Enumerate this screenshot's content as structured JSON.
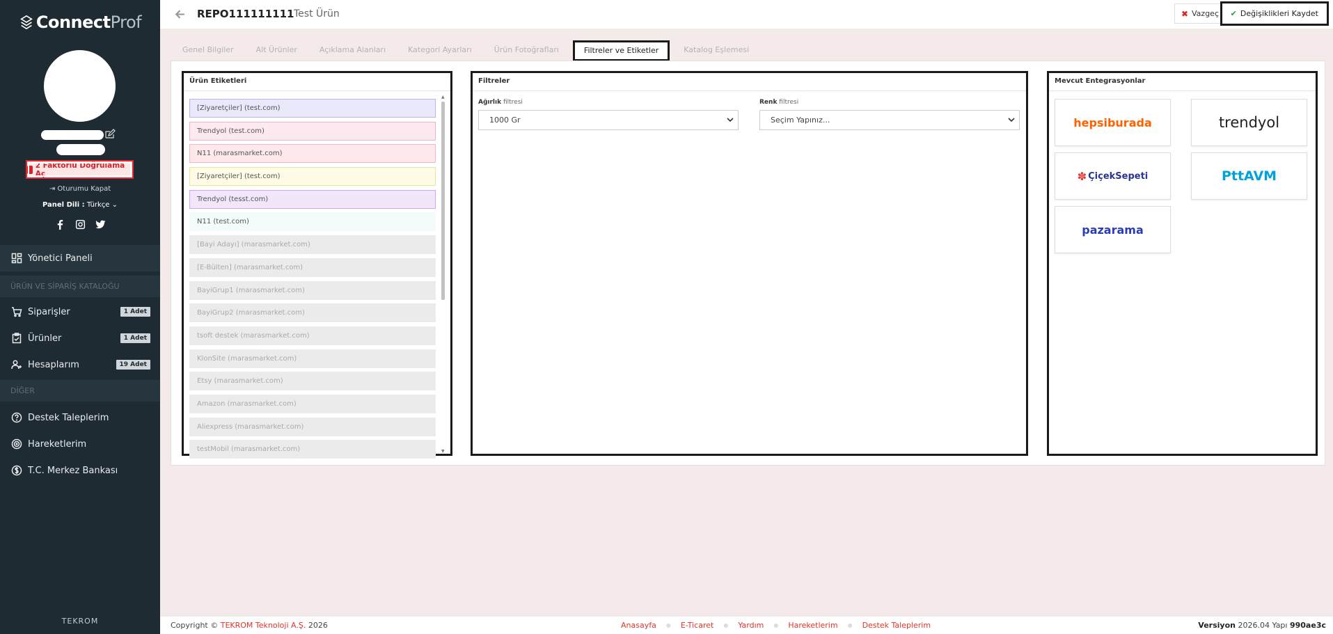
{
  "sidebar": {
    "logo_bold": "Connect",
    "logo_light": "Prof",
    "twofa_label": "2 Faktörlü Doğrulama Aç",
    "logout_label": "Oturumu Kapat",
    "lang_label": "Panel Dili :",
    "lang_value": "Türkçe",
    "items": [
      {
        "label": "Yönetici Paneli",
        "icon": "dashboard-icon"
      },
      {
        "label": "Siparişler",
        "icon": "cart-icon",
        "badge": "1 Adet"
      },
      {
        "label": "Ürünler",
        "icon": "clipboard-icon",
        "badge": "1 Adet"
      },
      {
        "label": "Hesaplarım",
        "icon": "users-icon",
        "badge": "19 Adet"
      },
      {
        "label": "Destek Taleplerim",
        "icon": "help-icon"
      },
      {
        "label": "Hareketlerim",
        "icon": "activity-icon"
      },
      {
        "label": "T.C. Merkez Bankası",
        "icon": "currency-icon"
      }
    ],
    "sections": [
      "ÜRÜN VE SİPARİŞ KATALOĞU",
      "DİĞER"
    ],
    "footer_brand": "TEKROM"
  },
  "topbar": {
    "code": "REPO111111111",
    "name": "Test Ürün",
    "cancel_label": "Vazgeç",
    "save_label": "Değişiklikleri Kaydet"
  },
  "tabs": [
    "Genel Bilgiler",
    "Alt Ürünler",
    "Açıklama Alanları",
    "Kategori Ayarları",
    "Ürün Fotoğrafları",
    "Filtreler ve Etiketler",
    "Katalog Eşlemesi"
  ],
  "tags_panel": {
    "title": "Ürün Etiketleri",
    "tags": [
      {
        "label": "[Ziyaretçiler] (test.com)",
        "bg": "#e9e9fb",
        "border": "#b5b5e8",
        "color": "#555"
      },
      {
        "label": "Trendyol (test.com)",
        "bg": "#fde9f0",
        "border": "#f1b2c8",
        "color": "#555"
      },
      {
        "label": "N11 (marasmarket.com)",
        "bg": "#fde9ec",
        "border": "#f2b8c2",
        "color": "#555"
      },
      {
        "label": "[Ziyaretçiler] (test.com)",
        "bg": "#fdfbe6",
        "border": "#ece59f",
        "color": "#555"
      },
      {
        "label": "Trendyol (tesst.com)",
        "bg": "#f2e6fa",
        "border": "#cfa6ea",
        "color": "#555"
      },
      {
        "label": "N11 (test.com)",
        "bg": "#f3fbfd",
        "border": "#f3fbfd",
        "color": "#555"
      },
      {
        "label": "[Bayi Adayı] (marasmarket.com)",
        "bg": "#ebebeb",
        "border": "#ebebeb",
        "color": "#aaa"
      },
      {
        "label": "[E-Bülten] (marasmarket.com)",
        "bg": "#ebebeb",
        "border": "#ebebeb",
        "color": "#aaa"
      },
      {
        "label": "BayiGrup1 (marasmarket.com)",
        "bg": "#ebebeb",
        "border": "#ebebeb",
        "color": "#aaa"
      },
      {
        "label": "BayiGrup2 (marasmarket.com)",
        "bg": "#ebebeb",
        "border": "#ebebeb",
        "color": "#aaa"
      },
      {
        "label": "tsoft destek (marasmarket.com)",
        "bg": "#ebebeb",
        "border": "#ebebeb",
        "color": "#aaa"
      },
      {
        "label": "KlonSite (marasmarket.com)",
        "bg": "#ebebeb",
        "border": "#ebebeb",
        "color": "#aaa"
      },
      {
        "label": "Etsy (marasmarket.com)",
        "bg": "#ebebeb",
        "border": "#ebebeb",
        "color": "#aaa"
      },
      {
        "label": "Amazon (marasmarket.com)",
        "bg": "#ebebeb",
        "border": "#ebebeb",
        "color": "#aaa"
      },
      {
        "label": "Aliexpress (marasmarket.com)",
        "bg": "#ebebeb",
        "border": "#ebebeb",
        "color": "#aaa"
      },
      {
        "label": "testMobil (marasmarket.com)",
        "bg": "#ebebeb",
        "border": "#ebebeb",
        "color": "#aaa"
      }
    ]
  },
  "filters_panel": {
    "title": "Filtreler",
    "weight": {
      "label_bold": "Ağırlık",
      "label_rest": " filtresi",
      "value": "1000 Gr"
    },
    "color": {
      "label_bold": "Renk",
      "label_rest": " filtresi",
      "value": "Seçim Yapınız..."
    }
  },
  "integrations_panel": {
    "title": "Mevcut Entegrasyonlar",
    "items": [
      {
        "name": "hepsiburada",
        "color": "#ff6000"
      },
      {
        "name": "trendyol",
        "color": "#222222"
      },
      {
        "name": "ÇiçekSepeti",
        "color": "#283593"
      },
      {
        "name": "PttAVM",
        "color": "#00a3d9"
      },
      {
        "name": "pazarama",
        "color": "#2a3db8"
      }
    ]
  },
  "footer": {
    "copyright": "Copyright ©",
    "company": "TEKROM Teknoloji A.Ş.",
    "year": "2026",
    "links": [
      "Anasayfa",
      "E-Ticaret",
      "Yardım",
      "Hareketlerim",
      "Destek Taleplerim"
    ],
    "version_label": "Versiyon",
    "version": "2026.04",
    "build_label": "Yapı",
    "build": "990ae3c"
  },
  "colors": {
    "accent": "#e0352b",
    "sidebar": "#1e2b32"
  }
}
